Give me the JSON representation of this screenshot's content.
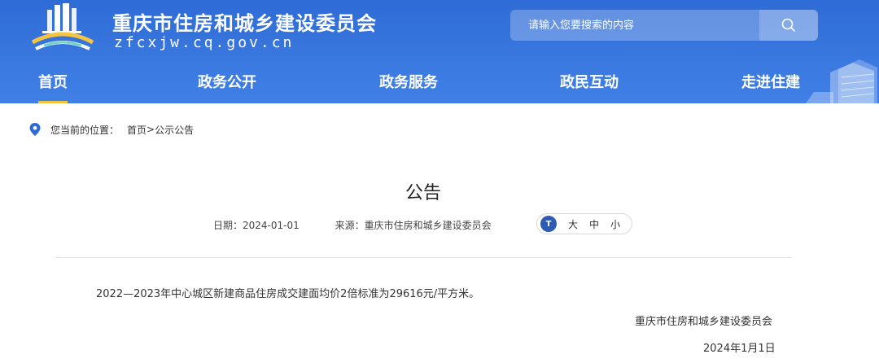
{
  "header": {
    "site_title": "重庆市住房和城乡建设委员会",
    "site_domain": "zfcxjw.cq.gov.cn"
  },
  "search": {
    "placeholder": "请输入您要搜索的内容"
  },
  "nav": {
    "items": [
      {
        "label": "首页",
        "active": true
      },
      {
        "label": "政务公开",
        "active": false
      },
      {
        "label": "政务服务",
        "active": false
      },
      {
        "label": "政民互动",
        "active": false
      },
      {
        "label": "走进住建",
        "active": false
      }
    ]
  },
  "breadcrumb": {
    "label": "您当前的位置：",
    "home": "首页",
    "separator": ">",
    "current": "公示公告"
  },
  "article": {
    "title": "公告",
    "date_label": "日期：",
    "date": "2024-01-01",
    "source_label": "来源：",
    "source": "重庆市住房和城乡建设委员会",
    "font_size": {
      "icon_text": "T",
      "large": "大",
      "medium": "中",
      "small": "小"
    },
    "body": "2022—2023年中心城区新建商品住房成交建面均价2倍标准为29616元/平方米。",
    "signature": "重庆市住房和城乡建设委员会",
    "sign_date": "2024年1月1日"
  },
  "colors": {
    "header_blue": "#3a79e0",
    "nav_active_underline": "#f5c542",
    "pin_blue": "#2f6bd6"
  }
}
